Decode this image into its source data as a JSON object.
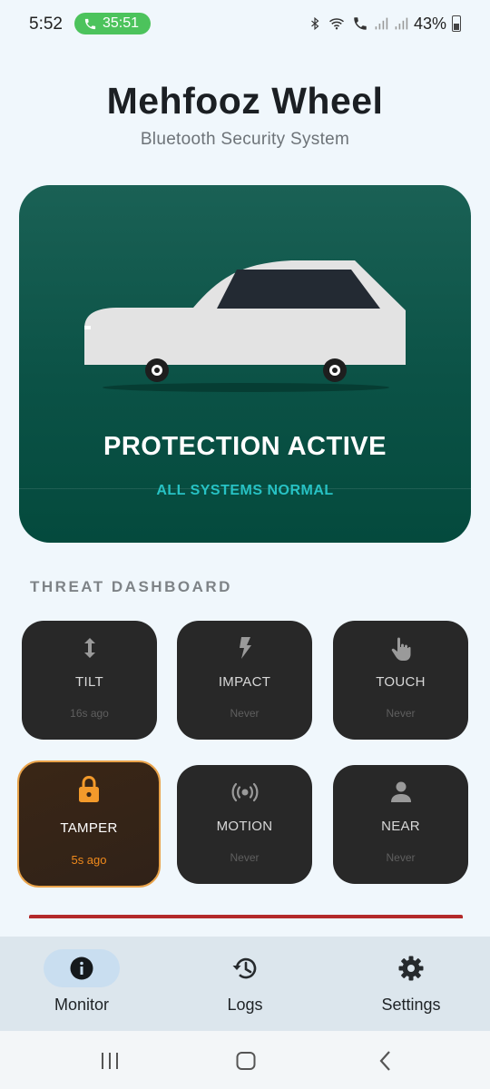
{
  "status_bar": {
    "time": "5:52",
    "call_timer": "35:51",
    "battery": "43%"
  },
  "header": {
    "title": "Mehfooz Wheel",
    "subtitle": "Bluetooth Security System"
  },
  "hero": {
    "status": "PROTECTION ACTIVE",
    "substatus": "ALL SYSTEMS NORMAL",
    "icon": "car-icon"
  },
  "dashboard": {
    "title": "THREAT DASHBOARD",
    "tiles": [
      {
        "label": "TILT",
        "last": "16s ago",
        "icon": "tilt-arrows-icon"
      },
      {
        "label": "IMPACT",
        "last": "Never",
        "icon": "lightning-icon"
      },
      {
        "label": "TOUCH",
        "last": "Never",
        "icon": "touch-hand-icon"
      },
      {
        "label": "TAMPER",
        "last": "5s ago",
        "icon": "lock-icon",
        "alert": true
      },
      {
        "label": "MOTION",
        "last": "Never",
        "icon": "radar-waves-icon"
      },
      {
        "label": "NEAR",
        "last": "Never",
        "icon": "person-icon"
      }
    ]
  },
  "bottom_nav": {
    "items": [
      {
        "label": "Monitor",
        "icon": "info-icon",
        "active": true
      },
      {
        "label": "Logs",
        "icon": "history-icon",
        "active": false
      },
      {
        "label": "Settings",
        "icon": "gear-icon",
        "active": false
      }
    ]
  },
  "colors": {
    "hero_bg": "#0b5246",
    "accent_teal": "#27c2c4",
    "alert_orange": "#f08a1c",
    "tile_bg": "#282828",
    "alert_red": "#b32a2a"
  }
}
